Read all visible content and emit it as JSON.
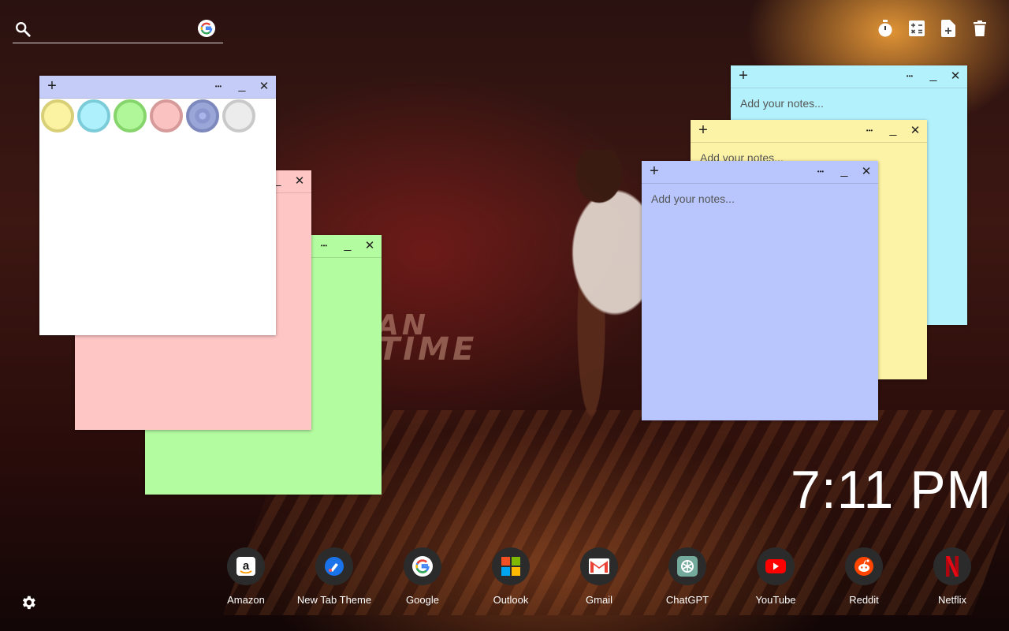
{
  "search": {
    "placeholder": "",
    "icon": "search-icon",
    "engine_icon": "google-icon"
  },
  "tools": [
    {
      "name": "timer",
      "icon": "stopwatch-icon"
    },
    {
      "name": "calculator",
      "icon": "calculator-icon"
    },
    {
      "name": "add-note",
      "icon": "note-add-icon"
    },
    {
      "name": "trash",
      "icon": "trash-icon"
    }
  ],
  "background": {
    "text_line1": "AN",
    "text_line2": "TIME"
  },
  "notes": {
    "white": {
      "color": "#ffffff",
      "bar_color": "#c5ccf8",
      "placeholder": ""
    },
    "pink": {
      "color": "#ffc6c6",
      "placeholder": ""
    },
    "green": {
      "color": "#b4fca0",
      "placeholder": ""
    },
    "cyan": {
      "color": "#b3f2fc",
      "placeholder": "Add your notes..."
    },
    "yellow": {
      "color": "#fdf3a6",
      "placeholder": "Add your notes..."
    },
    "blue": {
      "color": "#b8c6fd",
      "placeholder": "Add your notes..."
    },
    "add_symbol": "+",
    "more_symbol": "•••",
    "minimize_symbol": "_",
    "close_symbol": "✕"
  },
  "palette": [
    {
      "name": "yellow",
      "fill": "#fbf3a2",
      "ring": "#d9cf77"
    },
    {
      "name": "cyan",
      "fill": "#aef0fb",
      "ring": "#7ccbd9"
    },
    {
      "name": "green",
      "fill": "#b0f79a",
      "ring": "#85d56c"
    },
    {
      "name": "pink",
      "fill": "#fbc2c2",
      "ring": "#d79a9a"
    },
    {
      "name": "blue",
      "fill": "#9aa6d8",
      "ring": "#7d88bd"
    },
    {
      "name": "gray",
      "fill": "#ececec",
      "ring": "#c9c9c9"
    }
  ],
  "clock": {
    "time": "7:11 PM"
  },
  "shortcuts": [
    {
      "label": "Amazon",
      "icon": "amazon-icon"
    },
    {
      "label": "New Tab Theme",
      "icon": "new-tab-theme-icon"
    },
    {
      "label": "Google",
      "icon": "google-icon"
    },
    {
      "label": "Outlook",
      "icon": "microsoft-icon"
    },
    {
      "label": "Gmail",
      "icon": "gmail-icon"
    },
    {
      "label": "ChatGPT",
      "icon": "chatgpt-icon"
    },
    {
      "label": "YouTube",
      "icon": "youtube-icon"
    },
    {
      "label": "Reddit",
      "icon": "reddit-icon"
    },
    {
      "label": "Netflix",
      "icon": "netflix-icon"
    }
  ],
  "settings": {
    "icon": "gear-icon"
  }
}
